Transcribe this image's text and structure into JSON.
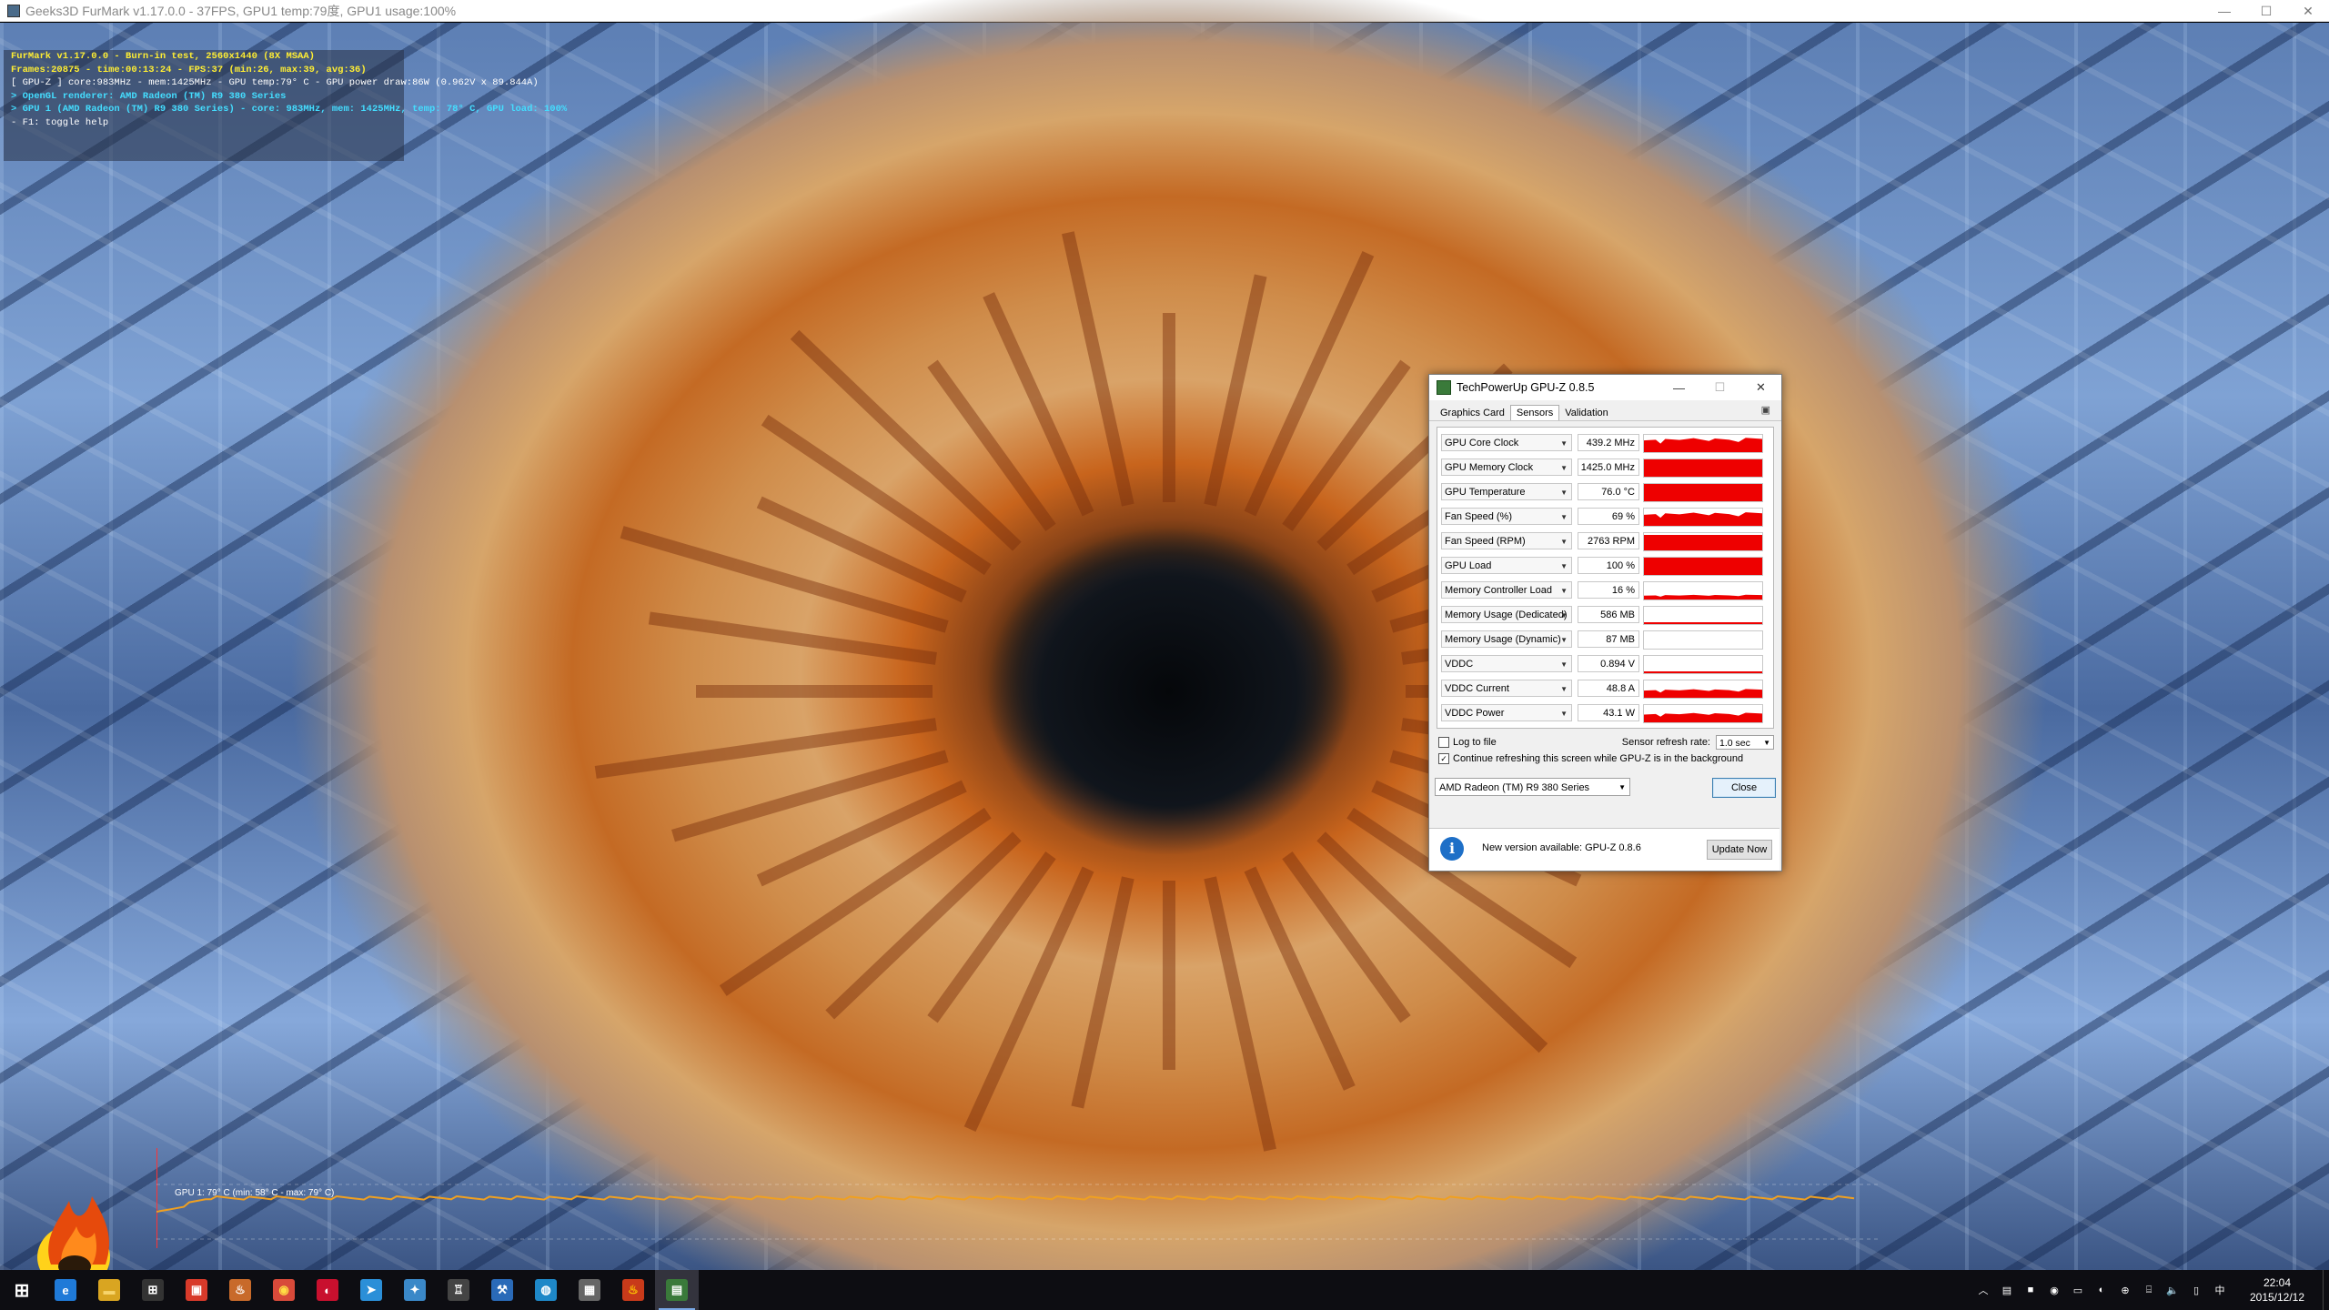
{
  "window": {
    "title": "Geeks3D FurMark v1.17.0.0 - 37FPS, GPU1 temp:79度, GPU1 usage:100%",
    "controls": [
      "—",
      "☐",
      "✕"
    ]
  },
  "hud": {
    "line1": "FurMark v1.17.0.0 - Burn-in test, 2560x1440 (8X MSAA)",
    "line2": "Frames:20875 - time:00:13:24 - FPS:37 (min:26, max:39, avg:36)",
    "line3": "[ GPU-Z ] core:983MHz - mem:1425MHz - GPU temp:79° C - GPU power draw:86W (0.962V x 89.844A)",
    "line4": "> OpenGL renderer: AMD Radeon (TM) R9 380 Series",
    "line5": "> GPU 1 (AMD Radeon (TM) R9 380 Series) - core: 983MHz, mem: 1425MHz, temp: 78° C, GPU load: 100%",
    "line6": "- F1: toggle help"
  },
  "temp_graph": {
    "label": "GPU 1: 79° C (min: 58° C - max: 79° C)",
    "line_color": "#f0a020"
  },
  "gpuz": {
    "title": "TechPowerUp GPU-Z 0.8.5",
    "controls": [
      "—",
      "☐",
      "✕"
    ],
    "tabs": [
      "Graphics Card",
      "Sensors",
      "Validation"
    ],
    "active_tab": "Sensors",
    "camera_icon": "camera-icon",
    "sensors": [
      {
        "name": "GPU Core Clock",
        "value": "439.2 MHz",
        "level": 0.9,
        "jagged": true
      },
      {
        "name": "GPU Memory Clock",
        "value": "1425.0 MHz",
        "level": 1.0,
        "jagged": false
      },
      {
        "name": "GPU Temperature",
        "value": "76.0 °C",
        "level": 1.0,
        "jagged": false
      },
      {
        "name": "Fan Speed (%)",
        "value": "69 %",
        "level": 0.85,
        "jagged": true
      },
      {
        "name": "Fan Speed (RPM)",
        "value": "2763 RPM",
        "level": 0.9,
        "jagged": false
      },
      {
        "name": "GPU Load",
        "value": "100 %",
        "level": 1.0,
        "jagged": false
      },
      {
        "name": "Memory Controller Load",
        "value": "16 %",
        "level": 0.3,
        "jagged": true
      },
      {
        "name": "Memory Usage (Dedicated)",
        "value": "586 MB",
        "level": 0.12,
        "jagged": false
      },
      {
        "name": "Memory Usage (Dynamic)",
        "value": "87 MB",
        "level": 0.0,
        "jagged": false
      },
      {
        "name": "VDDC",
        "value": "0.894 V",
        "level": 0.12,
        "jagged": false
      },
      {
        "name": "VDDC Current",
        "value": "48.8 A",
        "level": 0.55,
        "jagged": true
      },
      {
        "name": "VDDC Power",
        "value": "43.1 W",
        "level": 0.6,
        "jagged": true
      }
    ],
    "log_to_file": "Log to file",
    "log_checked": false,
    "refresh_label": "Sensor refresh rate:",
    "refresh_value": "1.0 sec",
    "continue_label": "Continue refreshing this screen while GPU-Z is in the background",
    "continue_checked": true,
    "gpu_select": "AMD Radeon (TM) R9 380 Series",
    "close_label": "Close",
    "update_text": "New version available: GPU-Z 0.8.6",
    "update_button": "Update Now",
    "info_icon": "info-icon"
  },
  "taskbar": {
    "icons": [
      {
        "name": "start-icon",
        "glyph": "⊞",
        "color": "#ffffff",
        "bg": "transparent"
      },
      {
        "name": "edge-icon",
        "glyph": "e",
        "color": "#ffffff",
        "bg": "#1f7ad8"
      },
      {
        "name": "file-explorer-icon",
        "glyph": "▬",
        "color": "#f7d46b",
        "bg": "#d9a521"
      },
      {
        "name": "store-icon",
        "glyph": "⊞",
        "color": "#ffffff",
        "bg": "#333333"
      },
      {
        "name": "app-red-icon",
        "glyph": "▣",
        "color": "#ffffff",
        "bg": "#d83a2a"
      },
      {
        "name": "app-cup-icon",
        "glyph": "♨",
        "color": "#ffffff",
        "bg": "#c86a2a"
      },
      {
        "name": "chrome-icon",
        "glyph": "◉",
        "color": "#ffdd44",
        "bg": "#d84a3a"
      },
      {
        "name": "app-circle-icon",
        "glyph": "◐",
        "color": "#ffffff",
        "bg": "#c8102e"
      },
      {
        "name": "app-arrow-icon",
        "glyph": "➤",
        "color": "#ffffff",
        "bg": "#2b8fd8"
      },
      {
        "name": "app-network-icon",
        "glyph": "✦",
        "color": "#ffffff",
        "bg": "#3a88c8"
      },
      {
        "name": "app-tower-icon",
        "glyph": "♖",
        "color": "#ffffff",
        "bg": "#444444"
      },
      {
        "name": "app-tools-icon",
        "glyph": "⚒",
        "color": "#ffffff",
        "bg": "#2a6ab8"
      },
      {
        "name": "app-globe-icon",
        "glyph": "◍",
        "color": "#ffffff",
        "bg": "#1e88c8"
      },
      {
        "name": "app-image-icon",
        "glyph": "▦",
        "color": "#ffffff",
        "bg": "#666666"
      },
      {
        "name": "furmark-taskbar-icon",
        "glyph": "♨",
        "color": "#ffcc00",
        "bg": "#c83a1a"
      },
      {
        "name": "gpuz-taskbar-icon",
        "glyph": "▤",
        "color": "#ffffff",
        "bg": "#3a7a3a"
      }
    ],
    "active_index": 15,
    "tray_icons": [
      {
        "name": "chevron-up-icon",
        "glyph": "︿"
      },
      {
        "name": "tray-app1-icon",
        "glyph": "▤"
      },
      {
        "name": "tray-app2-icon",
        "glyph": "■"
      },
      {
        "name": "tray-app3-icon",
        "glyph": "◉"
      },
      {
        "name": "tray-app4-icon",
        "glyph": "▭"
      },
      {
        "name": "tray-app5-icon",
        "glyph": "◐"
      },
      {
        "name": "tray-app6-icon",
        "glyph": "⊕"
      },
      {
        "name": "network-icon",
        "glyph": "⌸"
      },
      {
        "name": "volume-icon",
        "glyph": "🔈"
      },
      {
        "name": "action-center-icon",
        "glyph": "▯"
      },
      {
        "name": "ime-icon",
        "glyph": "中"
      }
    ],
    "time": "22:04",
    "date": "2015/12/12"
  }
}
